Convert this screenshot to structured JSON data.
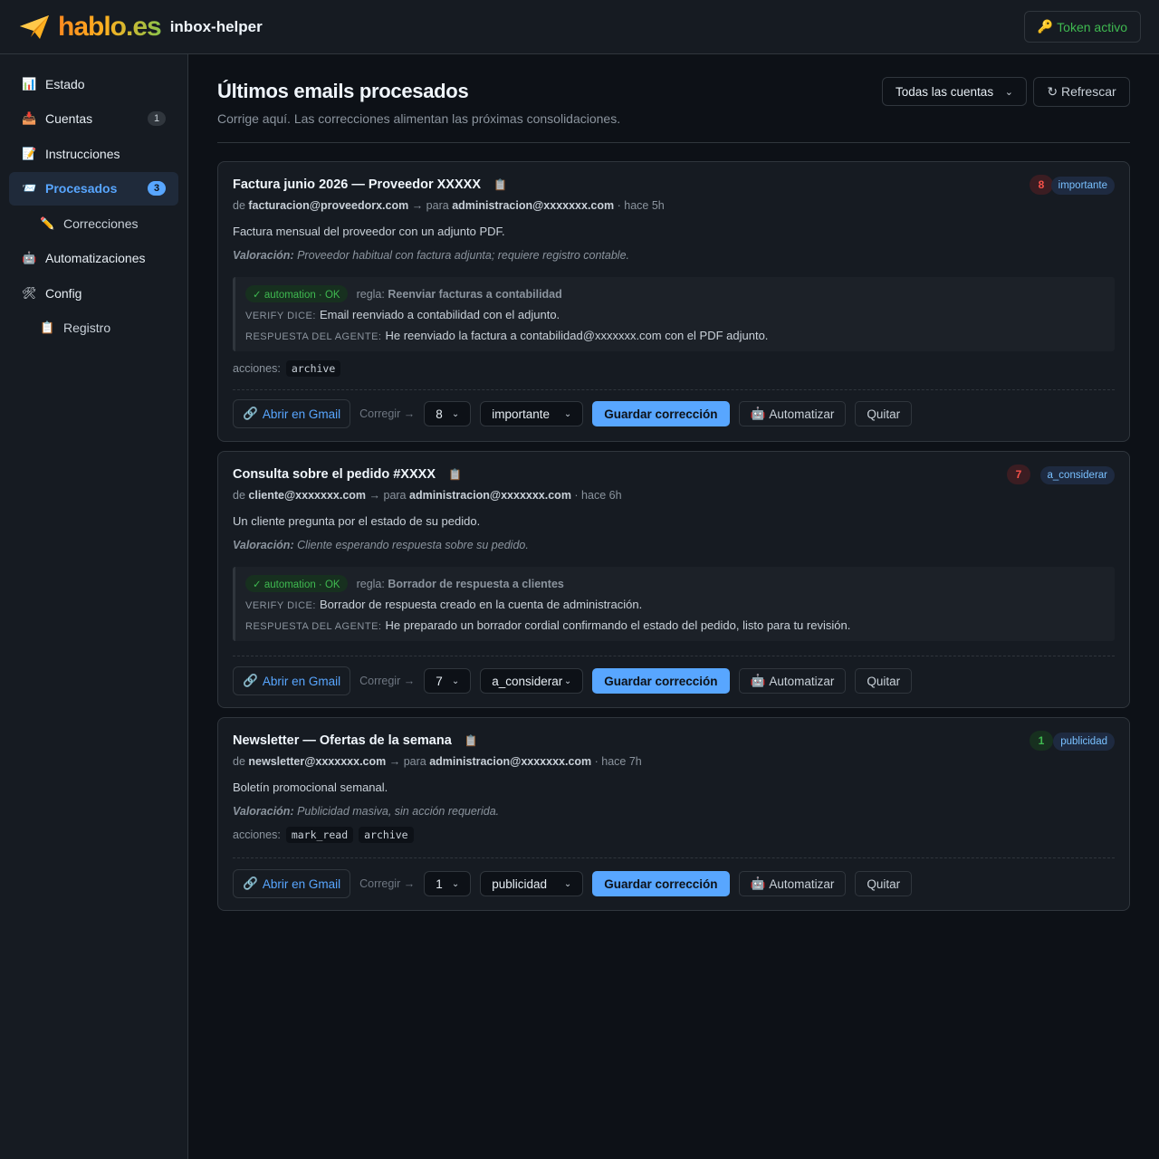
{
  "header": {
    "logo_text": "hablo.es",
    "app_name": "inbox-helper",
    "token_label": "Token activo",
    "token_icon": "key-icon"
  },
  "sidebar": {
    "items": [
      {
        "label": "Estado",
        "icon": "chart-icon",
        "glyph": "📊"
      },
      {
        "label": "Cuentas",
        "icon": "inbox-tray-icon",
        "glyph": "📥",
        "count": "1"
      },
      {
        "label": "Instrucciones",
        "icon": "memo-icon",
        "glyph": "📝"
      },
      {
        "label": "Procesados",
        "icon": "inbox-icon",
        "glyph": "📨",
        "count": "3",
        "active": true
      },
      {
        "label": "Correcciones",
        "icon": "pencil-icon",
        "glyph": "✏️",
        "sub": true
      },
      {
        "label": "Automatizaciones",
        "icon": "robot-icon",
        "glyph": "🤖"
      },
      {
        "label": "Config",
        "icon": "tools-icon",
        "glyph": "🛠"
      },
      {
        "label": "Registro",
        "icon": "clipboard-icon",
        "glyph": "📋",
        "sub": true
      }
    ]
  },
  "main": {
    "title": "Últimos emails procesados",
    "subtitle": "Corrige aquí. Las correcciones alimentan las próximas consolidaciones.",
    "account_filter": "Todas las cuentas",
    "refresh_label": "↻ Refrescar"
  },
  "common": {
    "from_label": "de",
    "to_label": "→ para",
    "valoracion_label": "Valoración:",
    "regla_label": "regla:",
    "verify_label": "Verify dice:",
    "respuesta_label": "Respuesta del agente:",
    "acciones_label": "acciones:",
    "gmail_label": "Abrir en Gmail",
    "corregir_label": "Corregir →",
    "save_label": "Guardar corrección",
    "automate_label": "Automatizar",
    "remove_label": "Quitar"
  },
  "emails": [
    {
      "subject": "Factura junio 2026 — Proveedor XXXXX",
      "score": "8",
      "category": "importante",
      "from": "facturacion@proveedorx.com",
      "to": "administracion@xxxxxxx.com",
      "time": "· hace 5h",
      "summary": "Factura mensual del proveedor con un adjunto PDF.",
      "valoracion": "Proveedor habitual con factura adjunta; requiere registro contable.",
      "automation": {
        "status": "✓ automation · OK",
        "rule": "Reenviar facturas a contabilidad",
        "verify": "Email reenviado a contabilidad con el adjunto.",
        "respuesta": "He reenviado la factura a contabilidad@xxxxxxx.com con el PDF adjunto."
      },
      "acciones": [
        "archive"
      ],
      "correct_score": "8",
      "correct_category": "importante"
    },
    {
      "subject": "Consulta sobre el pedido #XXXX",
      "score": "7",
      "category": "a_considerar",
      "from": "cliente@xxxxxxx.com",
      "to": "administracion@xxxxxxx.com",
      "time": "· hace 6h",
      "summary": "Un cliente pregunta por el estado de su pedido.",
      "valoracion": "Cliente esperando respuesta sobre su pedido.",
      "automation": {
        "status": "✓ automation · OK",
        "rule": "Borrador de respuesta a clientes",
        "verify": "Borrador de respuesta creado en la cuenta de administración.",
        "respuesta": "He preparado un borrador cordial confirmando el estado del pedido, listo para tu revisión."
      },
      "acciones": [],
      "correct_score": "7",
      "correct_category": "a_considerar"
    },
    {
      "subject": "Newsletter — Ofertas de la semana",
      "score": "1",
      "category": "publicidad",
      "from": "newsletter@xxxxxxx.com",
      "to": "administracion@xxxxxxx.com",
      "time": "· hace 7h",
      "summary": "Boletín promocional semanal.",
      "valoracion": "Publicidad masiva, sin acción requerida.",
      "acciones": [
        "mark_read",
        "archive"
      ],
      "correct_score": "1",
      "correct_category": "publicidad"
    }
  ],
  "colors": {
    "accent": "#58a6ff",
    "ok": "#3fb950",
    "danger": "#f85149",
    "background": "#0d1117",
    "panel": "#161b22"
  }
}
